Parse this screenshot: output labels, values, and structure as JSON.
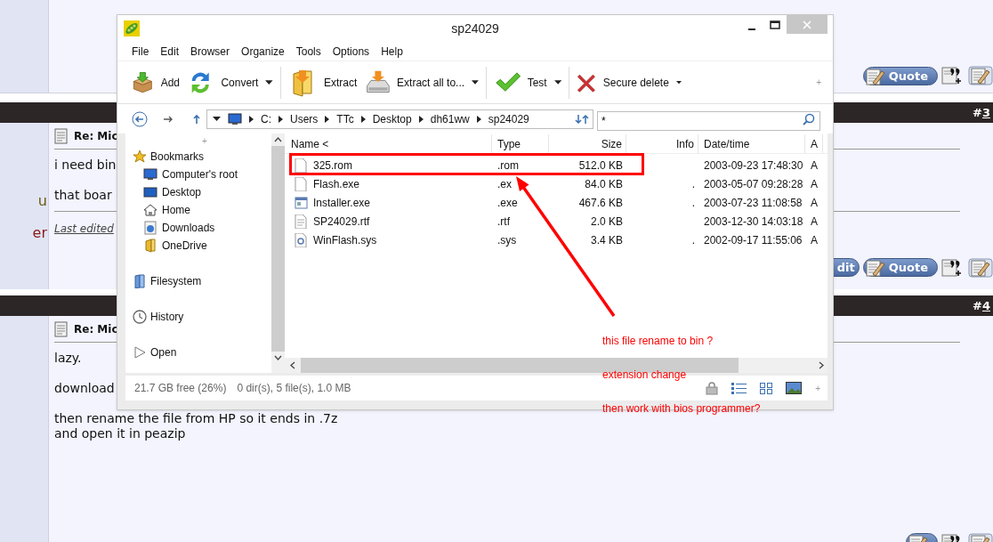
{
  "forum": {
    "top_buttons": [
      {
        "kind": "quote",
        "label": "Quote"
      },
      {
        "kind": "multiquote"
      },
      {
        "kind": "reply"
      }
    ],
    "posts": [
      {
        "number_prefix": "#",
        "number": "3",
        "side_texts": [
          {
            "text": "u",
            "color": "#6b5a10"
          },
          {
            "text": "er",
            "color": "#8b1a1a"
          }
        ],
        "title": "Re: Mic",
        "body": [
          "i need bin",
          "that boar"
        ],
        "edited": "Last edited",
        "buttons": [
          {
            "kind": "edit",
            "label": "dit"
          },
          {
            "kind": "quote",
            "label": "Quote"
          },
          {
            "kind": "multiquote"
          },
          {
            "kind": "reply"
          }
        ]
      },
      {
        "number_prefix": "#",
        "number": "4",
        "title": "Re: Mic",
        "body": [
          "lazy.",
          "download",
          "then rename the file from HP so it ends in .7z\nand open it in peazip"
        ],
        "buttons": [
          {
            "kind": "quote"
          },
          {
            "kind": "multiquote"
          },
          {
            "kind": "reply"
          }
        ]
      }
    ]
  },
  "window": {
    "title": "sp24029",
    "menu": [
      "File",
      "Edit",
      "Browser",
      "Organize",
      "Tools",
      "Options",
      "Help"
    ],
    "toolbar": [
      {
        "label": "Add",
        "dropdown": false
      },
      {
        "label": "Convert",
        "dropdown": true
      },
      {
        "label": "Extract",
        "dropdown": false
      },
      {
        "label": "Extract all to...",
        "dropdown": true
      },
      {
        "label": "Test",
        "dropdown": true
      },
      {
        "label": "Secure delete",
        "dropdown": true
      }
    ],
    "address": {
      "path": [
        "C:",
        "Users",
        "TTc",
        "Desktop",
        "dh61ww",
        "sp24029"
      ]
    },
    "toolbar_add": "+",
    "sidebar_add": "+",
    "status_add": "+",
    "search": {
      "value": "*"
    },
    "sidebar": [
      {
        "label": "Bookmarks",
        "children": [
          {
            "label": "Computer's root"
          },
          {
            "label": "Desktop"
          },
          {
            "label": "Home"
          },
          {
            "label": "Downloads"
          },
          {
            "label": "OneDrive"
          }
        ]
      },
      {
        "label": "Filesystem"
      },
      {
        "label": "History"
      },
      {
        "label": "Open"
      }
    ],
    "columns": [
      "Name <",
      "Type",
      "Size",
      "Info",
      "Date/time",
      "A"
    ],
    "rows": [
      {
        "name": "325.rom",
        "type": ".rom",
        "size": "512.0 KB",
        "info": "",
        "date": "2003-09-23 17:48:30",
        "attr": "A",
        "marked": true
      },
      {
        "name": "Flash.exe",
        "type": ".ex",
        "size": "84.0 KB",
        "info": ".",
        "date": "2003-05-07 09:28:28",
        "attr": "A",
        "marked": false
      },
      {
        "name": "Installer.exe",
        "type": ".exe",
        "size": "467.6 KB",
        "info": ".",
        "date": "2003-07-23 11:08:58",
        "attr": "A",
        "marked": false
      },
      {
        "name": "SP24029.rtf",
        "type": ".rtf",
        "size": "2.0 KB",
        "info": "",
        "date": "2003-12-30 14:03:18",
        "attr": "A",
        "marked": false
      },
      {
        "name": "WinFlash.sys",
        "type": ".sys",
        "size": "3.4 KB",
        "info": ".",
        "date": "2002-09-17 11:55:06",
        "attr": "A",
        "marked": false
      }
    ],
    "status": {
      "free": "21.7 GB free (26%)",
      "summary": "0 dir(s), 5 file(s), 1.0 MB"
    }
  },
  "annotation": {
    "notes": [
      "this file rename to bin ?",
      "extension change",
      "then work with bios programmer?"
    ]
  }
}
